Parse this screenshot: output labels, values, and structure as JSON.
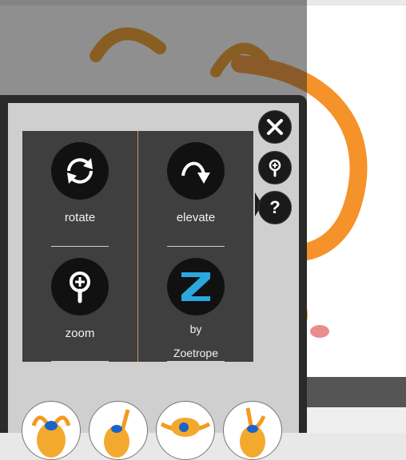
{
  "controls": {
    "rotate": {
      "label": "rotate",
      "icon": "rotate-icon"
    },
    "elevate": {
      "label": "elevate",
      "icon": "elevate-icon"
    },
    "zoom": {
      "label": "zoom",
      "icon": "zoom-icon"
    },
    "zoetrope": {
      "label_line1": "by",
      "label_line2": "Zoetrope",
      "icon": "zoetrope-logo-icon"
    }
  },
  "side_buttons": [
    "close-icon",
    "pin-icon",
    "help-icon"
  ],
  "thumbnails": [
    "thumbnail-1",
    "thumbnail-2",
    "thumbnail-3",
    "thumbnail-4"
  ],
  "colors": {
    "accent_blue": "#2aa8e0",
    "plush_orange": "#f39a1e",
    "panel_dark": "#1e1e1e"
  }
}
